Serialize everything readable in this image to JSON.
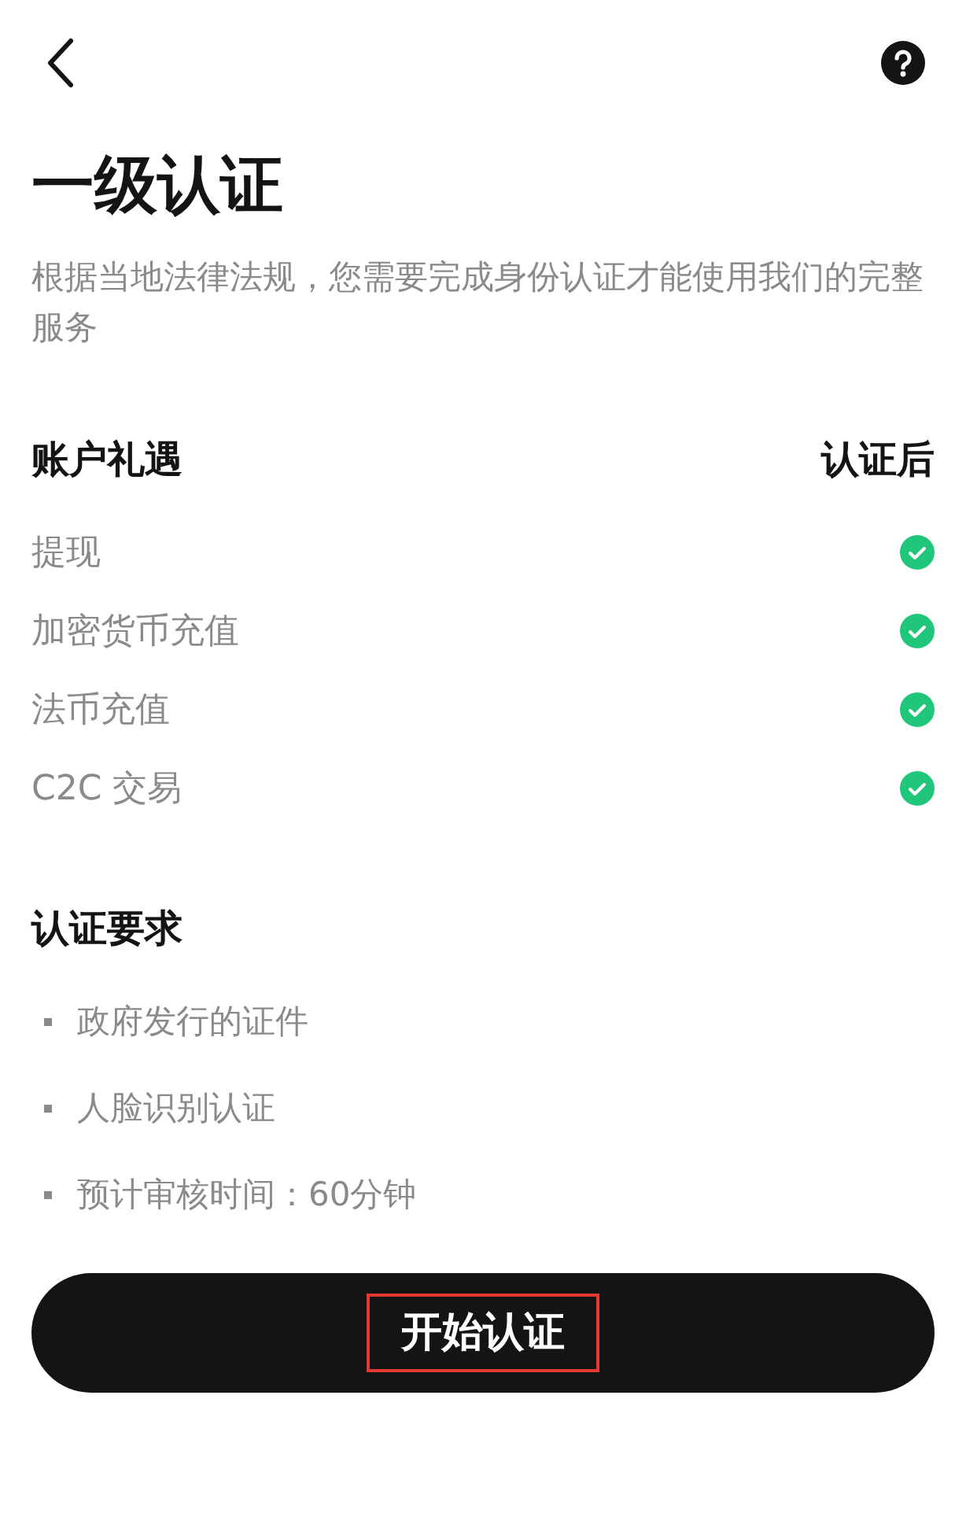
{
  "title": "一级认证",
  "description": "根据当地法律法规，您需要完成身份认证才能使用我们的完整服务",
  "benefits": {
    "heading": "账户礼遇",
    "column": "认证后",
    "items": [
      {
        "label": "提现",
        "checked": true
      },
      {
        "label": "加密货币充值",
        "checked": true
      },
      {
        "label": "法币充值",
        "checked": true
      },
      {
        "label": "C2C 交易",
        "checked": true
      }
    ]
  },
  "requirements": {
    "heading": "认证要求",
    "items": [
      "政府发行的证件",
      "人脸识别认证",
      "预计审核时间：60分钟"
    ]
  },
  "button": {
    "label": "开始认证",
    "highlighted": true
  }
}
